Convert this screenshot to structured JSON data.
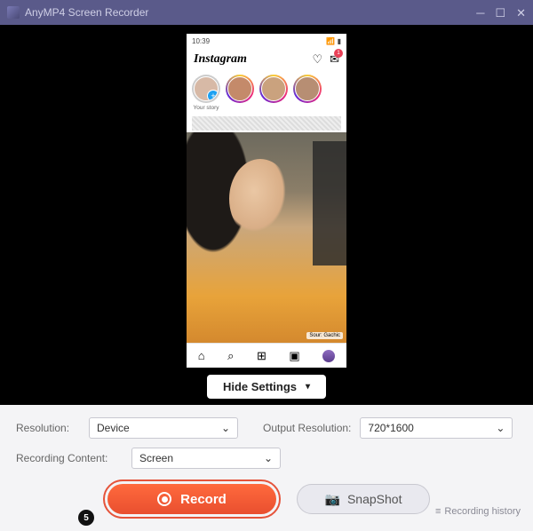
{
  "window": {
    "title": "AnyMP4 Screen Recorder"
  },
  "phone": {
    "status_time": "10:39",
    "app_name": "Instagram",
    "badge_count": "1",
    "your_story_label": "Your story",
    "caption_attribution": "Sour: Gachic"
  },
  "hide_settings_label": "Hide Settings",
  "settings": {
    "resolution_label": "Resolution:",
    "resolution_value": "Device",
    "output_label": "Output Resolution:",
    "output_value": "720*1600",
    "content_label": "Recording Content:",
    "content_value": "Screen"
  },
  "actions": {
    "record_label": "Record",
    "snapshot_label": "SnapShot",
    "history_label": "Recording history",
    "step_number": "5"
  }
}
